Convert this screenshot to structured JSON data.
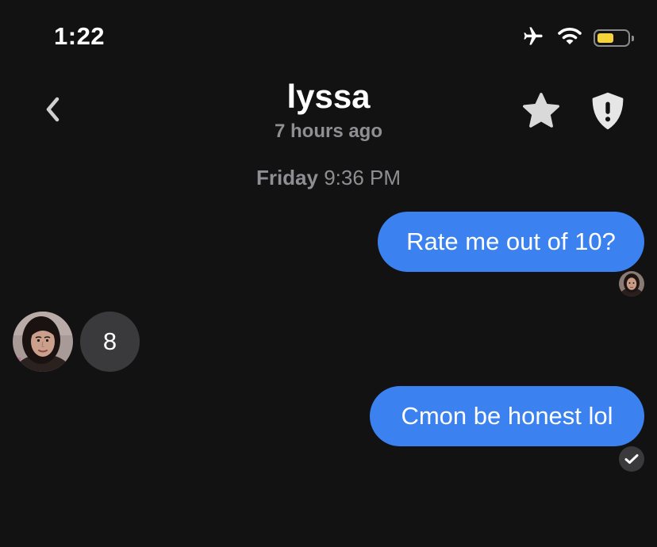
{
  "status_bar": {
    "time": "1:22",
    "icons": [
      "airplane-icon",
      "wifi-icon",
      "battery-icon"
    ],
    "battery_level": 0.55,
    "battery_color": "#f5d33b"
  },
  "header": {
    "title": "lyssa",
    "subtitle": "7 hours ago",
    "back_icon": "chevron-left-icon",
    "actions": [
      "star-icon",
      "shield-alert-icon"
    ]
  },
  "conversation": {
    "timestamp_day": "Friday",
    "timestamp_time": "9:36 PM",
    "messages": [
      {
        "direction": "outgoing",
        "text": "Rate me out of 10?",
        "receipt": "read-avatar"
      },
      {
        "direction": "incoming",
        "text": "8"
      },
      {
        "direction": "outgoing",
        "text": "Cmon be honest lol",
        "receipt": "delivered-check-icon"
      }
    ]
  },
  "colors": {
    "background": "#121212",
    "outgoing_bubble": "#3b82f0",
    "incoming_bubble": "#3a3a3c",
    "secondary_text": "#8e8e93"
  }
}
